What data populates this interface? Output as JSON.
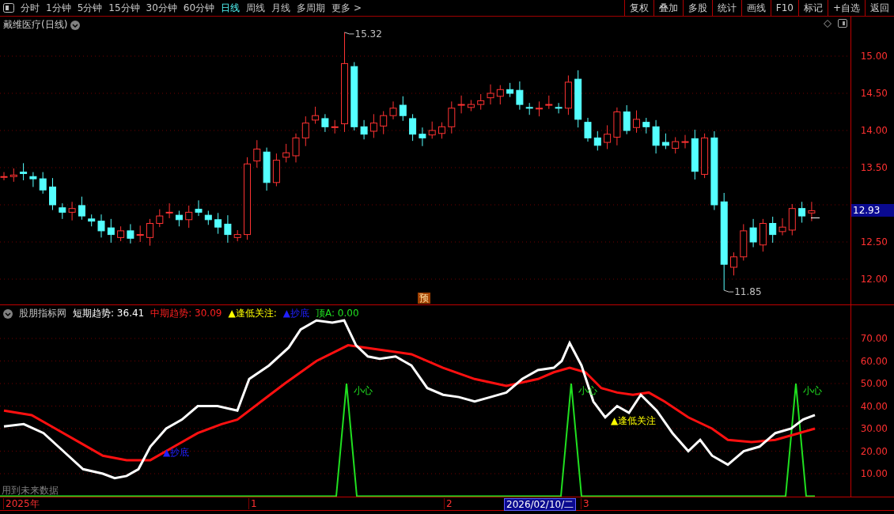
{
  "toolbar": {
    "periods": [
      {
        "label": "分时",
        "selected": false
      },
      {
        "label": "1分钟",
        "selected": false
      },
      {
        "label": "5分钟",
        "selected": false
      },
      {
        "label": "15分钟",
        "selected": false
      },
      {
        "label": "30分钟",
        "selected": false
      },
      {
        "label": "60分钟",
        "selected": false
      },
      {
        "label": "日线",
        "selected": true
      },
      {
        "label": "周线",
        "selected": false
      },
      {
        "label": "月线",
        "selected": false
      },
      {
        "label": "多周期",
        "selected": false
      },
      {
        "label": "更多 >",
        "selected": false
      }
    ],
    "actions": [
      "复权",
      "叠加",
      "多股",
      "统计",
      "画线",
      "F10",
      "标记",
      "+自选",
      "返回"
    ]
  },
  "price_panel": {
    "title": "戴维医疗(日线)",
    "axis_labels": [
      "15.00",
      "14.50",
      "14.00",
      "13.50",
      "12.50",
      "12.00"
    ],
    "current_price": "12.93",
    "high_label": "15.32",
    "low_label": "11.85",
    "marker": "预"
  },
  "indicator_panel": {
    "name": "股朋指标网",
    "legend": [
      {
        "text": "短期趋势: 36.41",
        "color": "#ffffff"
      },
      {
        "text": "中期趋势: 30.09",
        "color": "#ff2020"
      },
      {
        "text": "▲逢低关注:",
        "color": "#ffff00"
      },
      {
        "text": "▲抄底",
        "color": "#2020ff"
      },
      {
        "text": "顶A: 0.00",
        "color": "#20e020"
      }
    ],
    "axis_labels": [
      "70.00",
      "60.00",
      "50.00",
      "40.00",
      "30.00",
      "20.00",
      "10.00"
    ],
    "annotations": [
      {
        "text": "小心",
        "kind": "warning"
      },
      {
        "text": "小心",
        "kind": "warning"
      },
      {
        "text": "小心",
        "kind": "warning"
      },
      {
        "text": "▲逢低关注",
        "kind": "watch"
      },
      {
        "text": "▲抄底",
        "kind": "bottom"
      }
    ],
    "note": "用到未来数据"
  },
  "time_axis": [
    {
      "label": "2025年",
      "selected": false
    },
    {
      "label": "1",
      "selected": false
    },
    {
      "label": "2",
      "selected": false
    },
    {
      "label": "2026/02/10/二",
      "selected": true
    },
    {
      "label": "3",
      "selected": false
    }
  ]
}
